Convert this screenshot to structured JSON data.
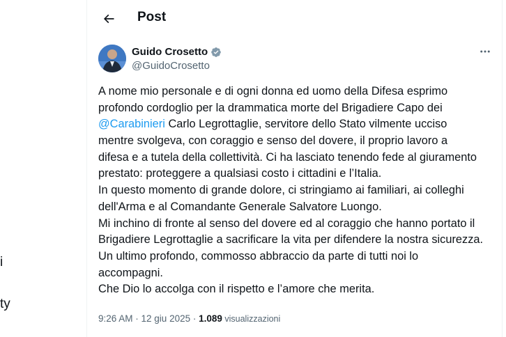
{
  "sidebar": {
    "items": [
      {
        "label": "i"
      },
      {
        "label": "ty"
      }
    ]
  },
  "header": {
    "title": "Post",
    "back_icon": "arrow-left-icon"
  },
  "author": {
    "name": "Guido Crosetto",
    "handle": "@GuidoCrosetto",
    "verified": true,
    "verified_color": "#829aab"
  },
  "tweet": {
    "lines": [
      {
        "parts": [
          {
            "text": "A nome mio personale e di ogni donna ed uomo della Difesa esprimo"
          }
        ]
      },
      {
        "parts": [
          {
            "text": "profondo cordoglio per la drammatica morte del Brigadiere Capo dei"
          }
        ]
      },
      {
        "parts": [
          {
            "text": "@Carabinieri",
            "mention": true
          },
          {
            "text": " Carlo Legrottaglie, servitore dello Stato vilmente ucciso"
          }
        ]
      },
      {
        "parts": [
          {
            "text": "mentre svolgeva, con coraggio e senso del dovere, il proprio lavoro a"
          }
        ]
      },
      {
        "parts": [
          {
            "text": "difesa e a tutela della collettività. Ci ha lasciato tenendo fede al giuramento"
          }
        ]
      },
      {
        "parts": [
          {
            "text": "prestato: proteggere a qualsiasi costo i cittadini e l’Italia."
          }
        ]
      },
      {
        "parts": [
          {
            "text": "In questo momento di grande dolore, ci stringiamo ai familiari, ai colleghi"
          }
        ]
      },
      {
        "parts": [
          {
            "text": "dell'Arma e al Comandante Generale Salvatore Luongo."
          }
        ]
      },
      {
        "parts": [
          {
            "text": "Mi inchino di fronte al senso del dovere ed al coraggio che hanno portato il"
          }
        ]
      },
      {
        "parts": [
          {
            "text": "Brigadiere Legrottaglie a sacrificare la vita per difendere la nostra sicurezza."
          }
        ]
      },
      {
        "parts": [
          {
            "text": "Un ultimo profondo, commosso abbraccio da parte di tutti noi lo"
          }
        ]
      },
      {
        "parts": [
          {
            "text": "accompagni."
          }
        ]
      },
      {
        "parts": [
          {
            "text": "Che Dio lo accolga con il rispetto e l’amore che merita."
          }
        ]
      }
    ]
  },
  "meta": {
    "time": "9:26 AM",
    "separator1": " · ",
    "date": "12 giu 2025",
    "separator2": " · ",
    "views_count": "1.089",
    "views_label": " visualizzazioni"
  },
  "colors": {
    "text": "#0f1419",
    "secondary": "#536471",
    "link": "#1d9bf0",
    "border": "#eff3f4"
  }
}
